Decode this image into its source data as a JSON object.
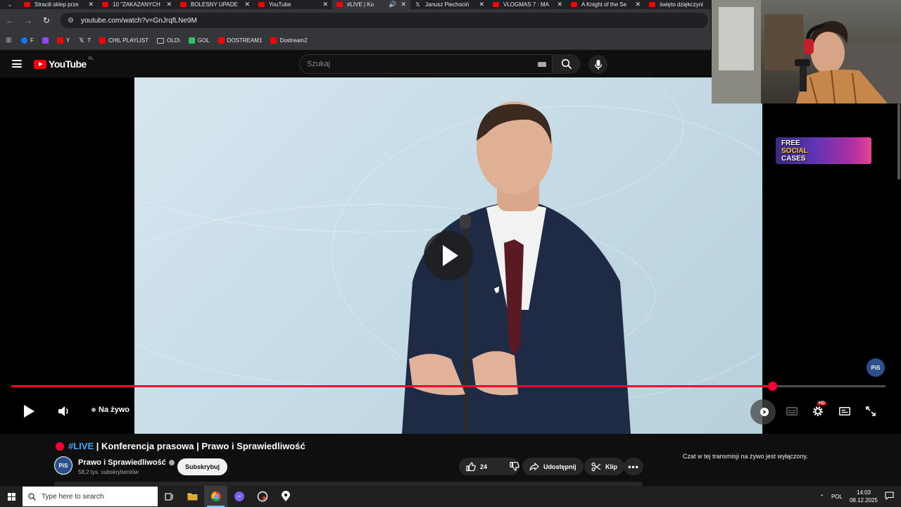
{
  "browser": {
    "tabs": [
      {
        "title": "Stracili sklep prze",
        "icon": "youtube-icon",
        "active": false
      },
      {
        "title": "10 \"ZAKAZANYCH",
        "icon": "youtube-icon",
        "active": false
      },
      {
        "title": "BOLESNY UPADE",
        "icon": "youtube-icon",
        "active": false
      },
      {
        "title": "YouTube",
        "icon": "youtube-icon",
        "active": false
      },
      {
        "title": "#LIVE | Ko",
        "icon": "youtube-icon",
        "active": true
      },
      {
        "title": "Janusz Piechociń",
        "icon": "x-icon",
        "active": false
      },
      {
        "title": "VLOGMAS 7 : MA",
        "icon": "youtube-icon",
        "active": false
      },
      {
        "title": "A Knight of the Se",
        "icon": "youtube-icon",
        "active": false
      },
      {
        "title": "święto dziękczyni",
        "icon": "youtube-icon",
        "active": false
      }
    ],
    "url": "youtube.com/watch?v=GnJrqfLNe9M",
    "bookmarks": [
      {
        "label": "F",
        "icon": "facebook-icon"
      },
      {
        "label": "",
        "icon": "twitch-icon"
      },
      {
        "label": "Y",
        "icon": "youtube-icon"
      },
      {
        "label": "T",
        "icon": "x-icon"
      },
      {
        "label": "CHIL PLAYLIST",
        "icon": "youtube-icon"
      },
      {
        "label": "OLD\\",
        "icon": "folder-icon"
      },
      {
        "label": "GOL",
        "icon": "gol-icon"
      },
      {
        "label": "DOSTREAM1",
        "icon": "youtube-icon"
      },
      {
        "label": "Dostream2",
        "icon": "youtube-icon"
      }
    ]
  },
  "youtube": {
    "logo_text": "YouTube",
    "country_code": "PL",
    "search_placeholder": "Szukaj",
    "player": {
      "live_label": "Na żywo",
      "hd_badge": "HD",
      "progress_fraction": 0.87,
      "watermark": "PiS"
    },
    "video": {
      "live_tag": "#LIVE",
      "title_rest": " | Konferencja prasowa | Prawo i Sprawiedliwość",
      "channel_name": "Prawo i Sprawiedliwość",
      "channel_avatar_text": "PiS",
      "subscribers": "58,2 tys. subskrybentów",
      "subscribe_label": "Subskrybuj",
      "likes": "24",
      "share_label": "Udostępnij",
      "clip_label": "Klip"
    },
    "chat_disabled_text": "Czat w tej transmisji na żywo jest wyłączony."
  },
  "overlay": {
    "ad_line1": "FREE",
    "ad_line2": "SOCIAL",
    "ad_line3": "CASES"
  },
  "taskbar": {
    "search_placeholder": "Type here to search",
    "language": "POL",
    "time": "14:03",
    "date": "08.12.2025"
  },
  "colors": {
    "youtube_red": "#ff0000",
    "progress_red": "#ff0033",
    "link_blue": "#3ea6ff"
  }
}
